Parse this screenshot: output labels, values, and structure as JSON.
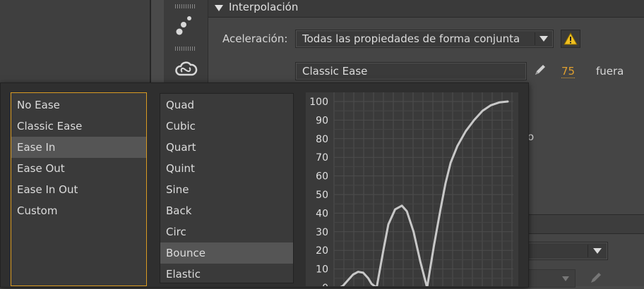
{
  "section": {
    "title": "Interpolación"
  },
  "ease_row": {
    "label": "Aceleración:",
    "scope_value": "Todas las propiedades de forma conjunta",
    "ease_type": "Classic Ease",
    "ease_value": "75",
    "direction": "fuera"
  },
  "background_fragments": {
    "partial_text": "o"
  },
  "ease_categories": [
    "No Ease",
    "Classic Ease",
    "Ease In",
    "Ease Out",
    "Ease In Out",
    "Custom"
  ],
  "ease_categories_selected": "Ease In",
  "ease_presets": [
    "Quad",
    "Cubic",
    "Quart",
    "Quint",
    "Sine",
    "Back",
    "Circ",
    "Bounce",
    "Elastic"
  ],
  "ease_presets_selected": "Bounce",
  "chart_data": {
    "type": "line",
    "title": "",
    "xlabel": "",
    "ylabel": "",
    "y_ticks": [
      0,
      10,
      20,
      30,
      40,
      50,
      60,
      70,
      80,
      90,
      100
    ],
    "ylim": [
      0,
      100
    ],
    "xlim": [
      0,
      1
    ],
    "grid": true,
    "series": [
      {
        "x": [
          0,
          0.02,
          0.05,
          0.08,
          0.11,
          0.14,
          0.17,
          0.19,
          0.22,
          0.26,
          0.29,
          0.33,
          0.37,
          0.4,
          0.44,
          0.48,
          0.52,
          0.56,
          0.6,
          0.63,
          0.66,
          0.7,
          0.75,
          0.8,
          0.85,
          0.9,
          0.95,
          1.0
        ],
        "values": [
          0,
          1,
          4,
          7,
          8.5,
          8,
          5,
          2,
          0,
          20,
          34,
          42,
          44,
          41,
          30,
          14,
          0,
          22,
          42,
          56,
          67,
          76,
          84,
          90,
          95,
          98,
          99.5,
          100
        ]
      }
    ]
  },
  "icons": {
    "toolstrip": [
      "motion-dots-icon",
      "creative-cloud-icon"
    ],
    "warning": "warning-icon",
    "pencil": "pencil-icon",
    "dropdown": "chevron-down-icon",
    "collapse": "triangle-down-icon"
  },
  "colors": {
    "accent": "#d89a22",
    "warning": "#f0c020",
    "curve": "#c8c8c8"
  }
}
